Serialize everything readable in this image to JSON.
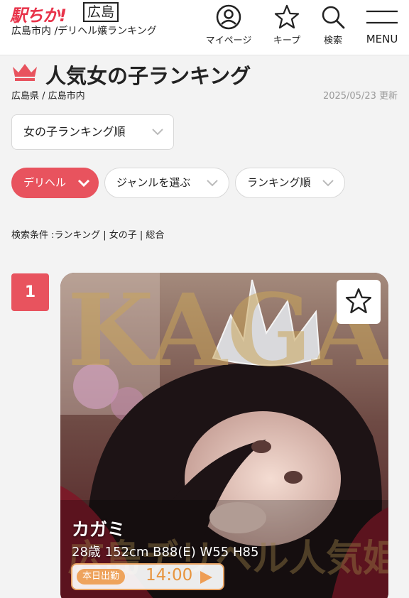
{
  "header": {
    "logo": "駅ちか!",
    "area": "広島",
    "subtitle": "広島市内 /デリヘル嬢ランキング",
    "nav": {
      "mypage": "マイページ",
      "keep": "キープ",
      "search": "検索",
      "menu": "MENU"
    }
  },
  "page": {
    "title": "人気女の子ランキング",
    "breadcrumb": "広島県 / 広島市内",
    "updated": "2025/05/23 更新"
  },
  "filters": {
    "sort": "女の子ランキング順",
    "category": "デリヘル",
    "genre": "ジャンルを選ぶ",
    "order": "ランキング順",
    "conditions": "検索条件 :ランキング | 女の子 | 総合"
  },
  "ranking": [
    {
      "rank": "1",
      "name": "カガミ",
      "profile": "28歳 152cm B88(E) W55 H85",
      "shift_label": "本日出勤",
      "shift_time": "14:00",
      "photo_text": "KAGAMI",
      "photo_caption": "広島デリヘル人気姫"
    }
  ],
  "colors": {
    "accent": "#e8535e",
    "brand": "#e8334a",
    "shift": "#e8953e"
  },
  "icons": [
    "user-circle-icon",
    "star-icon",
    "search-icon",
    "menu-icon",
    "crown-icon",
    "chevron-down-icon",
    "play-arrow-icon"
  ]
}
